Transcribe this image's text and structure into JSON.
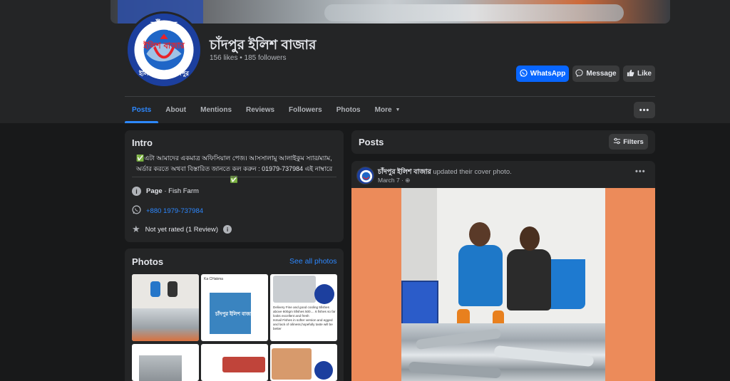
{
  "page": {
    "name": "চাঁদপুর ইলিশ বাজার",
    "stats": "156 likes • 185 followers",
    "logo_text_top": "চাঁদপুর",
    "logo_text_mid": "ইলিশ বাজার",
    "logo_text_bottom": "ইলিশের বাড়ি চাঁদপুর"
  },
  "actions": {
    "whatsapp": "WhatsApp",
    "message": "Message",
    "like": "Like"
  },
  "tabs": [
    "Posts",
    "About",
    "Mentions",
    "Reviews",
    "Followers",
    "Photos",
    "More"
  ],
  "intro": {
    "title": "Intro",
    "bio_line1": "✅এটা আমাদের একমাত্র অফিসিয়াল পেজ। আসসালামু আলাইকুম স্যার/ম্যাম,",
    "bio_line2": "অর্ডার করতে অথবা বিস্তারিত জানতে কল করুন : 01979-737984 এই নাম্বারে ✅",
    "category_label": "Page",
    "category_value": " · Fish Farm",
    "phone": "+880 1979-737984",
    "rating": "Not yet rated (1 Review)"
  },
  "photos": {
    "title": "Photos",
    "see_all": "See all photos",
    "thumb_chat_name": "Ka CHakma",
    "thumb_chat_text": "Delivery Fine and good cooling 5fishes above 600gm 5fishes 500.... 6 fishes so far looks excellent and fresh",
    "thumb_chat_text2": "Ismail Fishes in softer version and egged and lack of oiliness,hopefully taste will be better",
    "thumb_logo_text": "চাঁদপুর ইলিশ বাজার"
  },
  "posts": {
    "title": "Posts",
    "filters": "Filters",
    "author": "চাঁদপুর ইলিশ বাজার",
    "action": " updated their cover photo.",
    "date": "March 7 · "
  },
  "colors": {
    "background": "#18191a",
    "card": "#242526",
    "accent": "#2d88ff",
    "whatsapp_button": "#0866ff",
    "post_photo_bg": "#ec8b5a"
  },
  "icons": [
    "whatsapp-icon",
    "messenger-icon",
    "thumbs-up-icon",
    "info-icon",
    "whatsapp-icon",
    "star-icon",
    "filter-icon",
    "globe-icon",
    "more-horizontal-icon",
    "chevron-down-icon"
  ]
}
